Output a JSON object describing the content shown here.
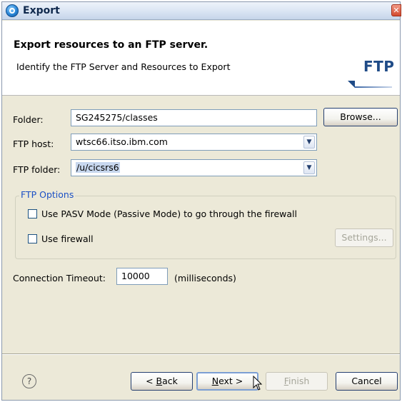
{
  "window": {
    "title": "Export"
  },
  "header": {
    "title": "Export resources to an FTP server.",
    "description": "Identify the FTP Server and Resources to Export",
    "logo_text": "FTP"
  },
  "form": {
    "folder_label": "Folder:",
    "folder_value": "SG245275/classes",
    "browse_label": "Browse...",
    "host_label": "FTP host:",
    "host_value": "wtsc66.itso.ibm.com",
    "ftp_folder_label": "FTP folder:",
    "ftp_folder_value": "/u/cicsrs6"
  },
  "options": {
    "group_label": "FTP Options",
    "pasv_label": "Use PASV Mode (Passive Mode) to go through the firewall",
    "firewall_label": "Use firewall",
    "settings_label": "Settings..."
  },
  "timeout": {
    "label": "Connection Timeout:",
    "value": "10000",
    "unit": "(milliseconds)"
  },
  "footer": {
    "help_icon": "?",
    "back_mnemonic": "B",
    "back_rest": "ack",
    "next_mnemonic": "N",
    "next_rest": "ext >",
    "finish_mnemonic": "F",
    "finish_rest": "inish",
    "cancel_label": "Cancel"
  },
  "colors": {
    "legend": "#1b50c5",
    "logo": "#1f4b87",
    "dialog_bg": "#ece9d8"
  }
}
